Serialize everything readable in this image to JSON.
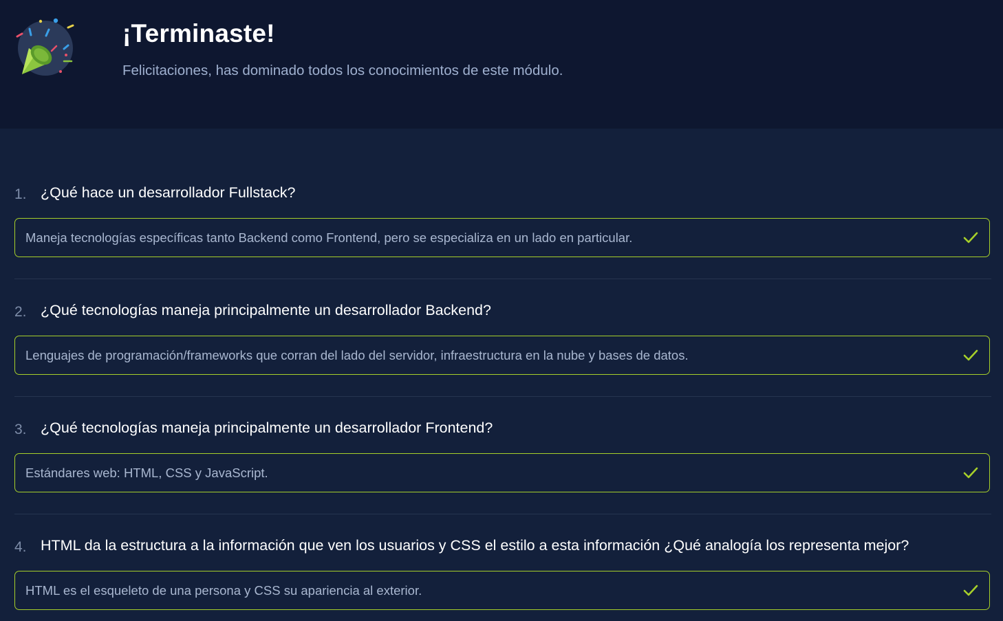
{
  "header": {
    "title": "¡Terminaste!",
    "subtitle": "Felicitaciones, has dominado todos los conocimientos de este módulo.",
    "logo_icon": "party-popper-icon"
  },
  "colors": {
    "background": "#13203b",
    "header_background": "#0e1730",
    "correct_border": "#a7d02a",
    "check": "#a7d02a"
  },
  "questions": [
    {
      "number": "1.",
      "text": "¿Qué hace un desarrollador Fullstack?",
      "answer": "Maneja tecnologías específicas tanto Backend como Frontend, pero se especializa en un lado en particular.",
      "status_icon": "check-icon"
    },
    {
      "number": "2.",
      "text": "¿Qué tecnologías maneja principalmente un desarrollador Backend?",
      "answer": "Lenguajes de programación/frameworks que corran del lado del servidor, infraestructura en la nube y bases de datos.",
      "status_icon": "check-icon"
    },
    {
      "number": "3.",
      "text": "¿Qué tecnologías maneja principalmente un desarrollador Frontend?",
      "answer": "Estándares web: HTML, CSS y JavaScript.",
      "status_icon": "check-icon"
    },
    {
      "number": "4.",
      "text": "HTML da la estructura a la información que ven los usuarios y CSS el estilo a esta información ¿Qué analogía los representa mejor?",
      "answer": "HTML es el esqueleto de una persona y CSS su apariencia al exterior.",
      "status_icon": "check-icon"
    }
  ]
}
